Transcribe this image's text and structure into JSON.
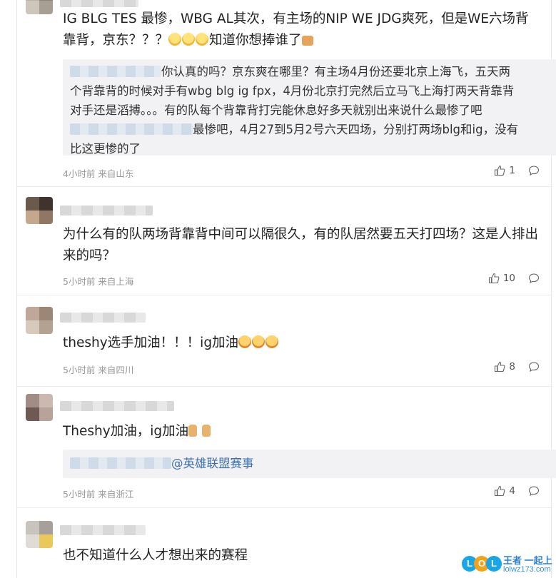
{
  "comments": [
    {
      "text_parts": [
        "IG BLG TES 最惨，WBG AL其次，有主场的NIP WE JDG爽死，但是WE六场背靠背，京东？？？",
        "知道你想捧谁了"
      ],
      "reply": {
        "line1": "你认真的吗？京东爽在哪里？有主场4月份还要北京上海飞，五天两",
        "line2": "个背靠背的时候对手有wbg blg ig fpx，4月份北京打完然后立马飞上海打两天背靠背",
        "line3a": "对手还是滔搏。。。有的队每个背靠背打完能休息好多天就别出来说什么最惨了吧",
        "line4": "最惨吧，4月27到5月2号六天四场，分别打两场blg和ig，没有",
        "line5": "比这更惨的了"
      },
      "meta": "4小时前 来自山东",
      "likes": "1"
    },
    {
      "text": "为什么有的队两场背靠背中间可以隔很久，有的队居然要五天打四场？这是人排出来的吗？",
      "meta": "5小时前 来自上海",
      "likes": "10"
    },
    {
      "text": "theshy选手加油！！！ig加油",
      "meta": "5小时前 来自四川",
      "likes": "8"
    },
    {
      "text": "Theshy加油，ig加油",
      "reply_mention": "@英雄联盟赛事",
      "meta": "5小时前 来自浙江",
      "likes": "4"
    },
    {
      "text": "也不知道什么人才想出来的赛程"
    }
  ],
  "icons": {
    "like": "thumbs-up-icon",
    "comment": "comment-bubble-icon"
  },
  "watermark": {
    "letters": [
      "L",
      "O",
      "L"
    ],
    "brand": "王者 一起上",
    "url": "lolwz173.com"
  }
}
